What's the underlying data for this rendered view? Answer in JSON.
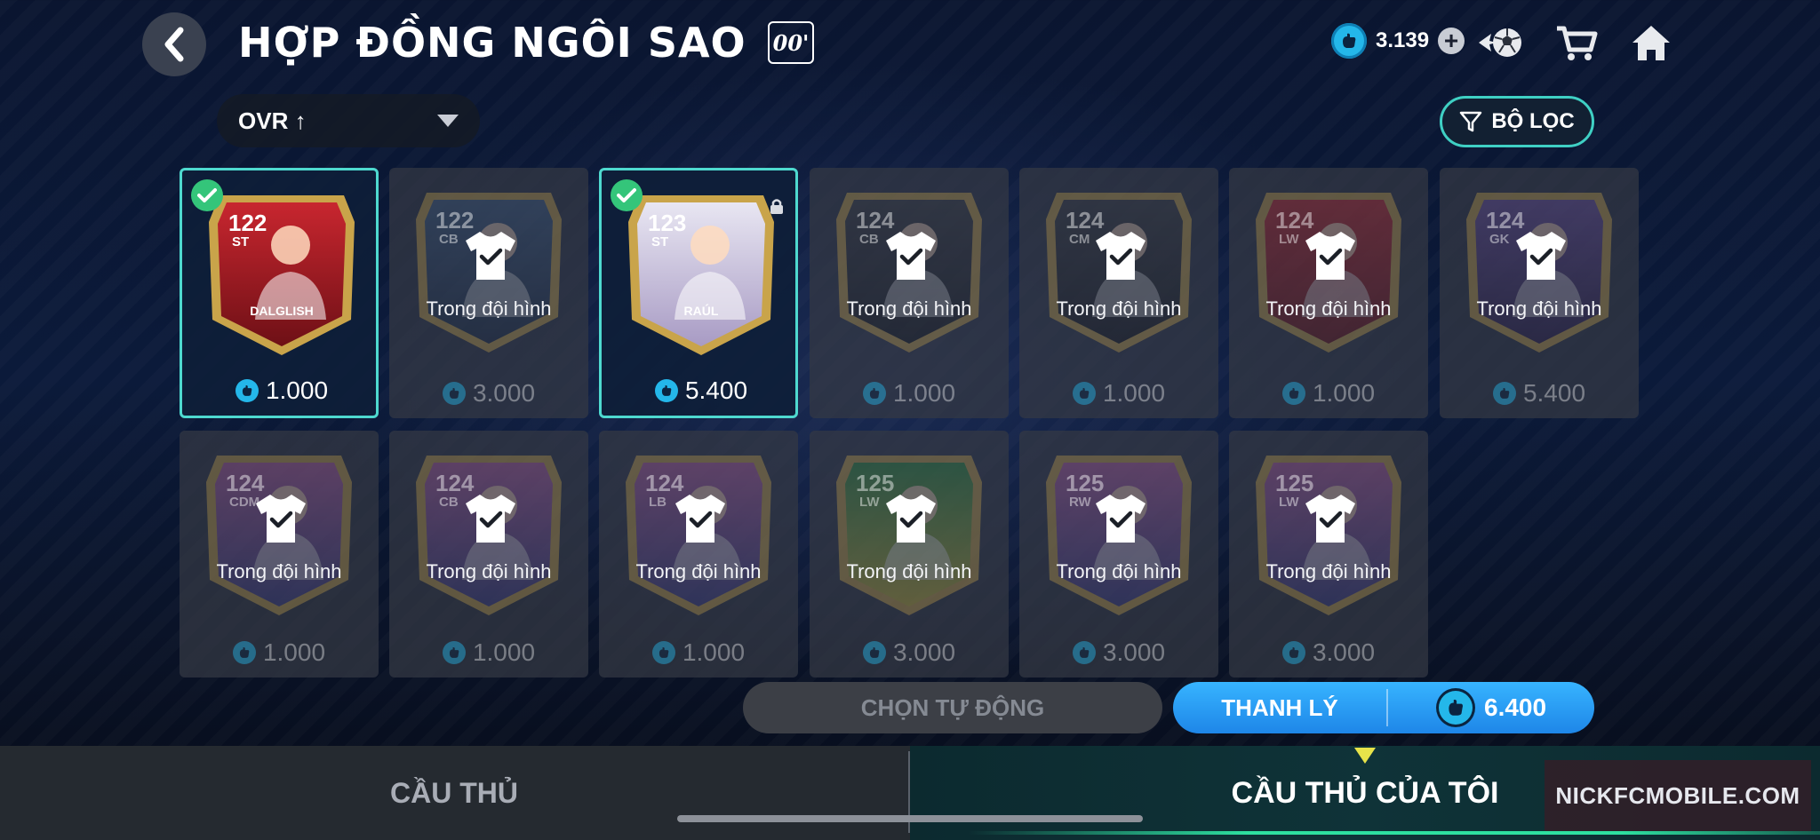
{
  "header": {
    "title": "HỢP ĐỒNG NGÔI SAO",
    "season_badge": "00'",
    "currency_value": "3.139"
  },
  "toolbar": {
    "sort_label": "OVR ↑",
    "filter_label": "BỘ LỌC"
  },
  "colors": {
    "accent": "#4ed9cf",
    "coin": "#24b7ea",
    "sell_button": "#2a9df4",
    "check": "#34c57a"
  },
  "cards": [
    {
      "ovr": "122",
      "pos": "ST",
      "name": "DALGLISH",
      "state": "selected",
      "price": "1.000",
      "art": "red"
    },
    {
      "ovr": "122",
      "pos": "CB",
      "label": "Trong đội hình",
      "state": "in-squad",
      "price": "3.000",
      "art": "blue"
    },
    {
      "ovr": "123",
      "pos": "ST",
      "name": "RAÚL",
      "state": "selected",
      "price": "5.400",
      "art": "white"
    },
    {
      "ovr": "124",
      "pos": "CB",
      "label": "Trong đội hình",
      "state": "in-squad",
      "price": "1.000",
      "art": "dark"
    },
    {
      "ovr": "124",
      "pos": "CM",
      "label": "Trong đội hình",
      "state": "in-squad",
      "price": "1.000",
      "art": "dark"
    },
    {
      "ovr": "124",
      "pos": "LW",
      "label": "Trong đội hình",
      "state": "in-squad",
      "price": "1.000",
      "art": "red"
    },
    {
      "ovr": "124",
      "pos": "GK",
      "label": "Trong đội hình",
      "state": "in-squad",
      "price": "5.400",
      "art": "purple"
    },
    {
      "ovr": "124",
      "pos": "CDM",
      "label": "Trong đội hình",
      "state": "in-squad",
      "price": "1.000",
      "art": "pink"
    },
    {
      "ovr": "124",
      "pos": "CB",
      "label": "Trong đội hình",
      "state": "in-squad",
      "price": "1.000",
      "art": "pink"
    },
    {
      "ovr": "124",
      "pos": "LB",
      "label": "Trong đội hình",
      "state": "in-squad",
      "price": "1.000",
      "art": "pink"
    },
    {
      "ovr": "125",
      "pos": "LW",
      "label": "Trong đội hình",
      "state": "in-squad",
      "price": "3.000",
      "art": "green"
    },
    {
      "ovr": "125",
      "pos": "RW",
      "label": "Trong đội hình",
      "state": "in-squad",
      "price": "3.000",
      "art": "pink"
    },
    {
      "ovr": "125",
      "pos": "LW",
      "label": "Trong đội hình",
      "state": "in-squad",
      "price": "3.000",
      "art": "pink"
    }
  ],
  "actions": {
    "auto_select_label": "CHỌN TỰ ĐỘNG",
    "sell_label": "THANH LÝ",
    "sell_total": "6.400"
  },
  "tabs": {
    "players": "CẦU THỦ",
    "my_players": "CẦU THỦ CỦA TÔI"
  },
  "watermark": "NICKFCMOBILE.COM",
  "icons": {
    "back": "chevron-left-icon",
    "coin": "coin-hand-icon",
    "plus": "plus-icon",
    "ball": "football-icon",
    "cart": "cart-icon",
    "home": "home-icon",
    "filter": "funnel-icon",
    "check": "check-icon",
    "lock": "lock-icon",
    "jersey": "jersey-check-icon"
  }
}
